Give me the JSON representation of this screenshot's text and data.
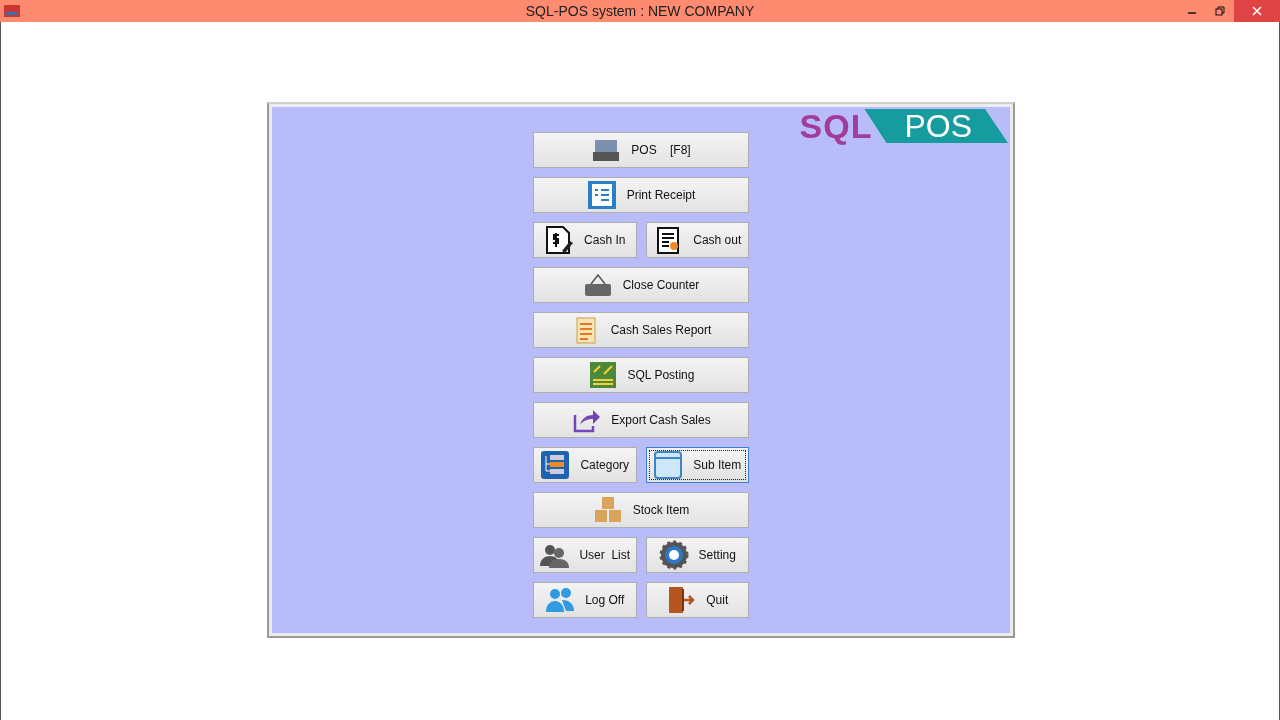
{
  "window": {
    "title": "SQL-POS system : NEW COMPANY"
  },
  "logo": {
    "left": "SQL",
    "right": "POS"
  },
  "rows": [
    [
      {
        "label": "POS    [F8]",
        "kind": "register",
        "focused": false
      }
    ],
    [
      {
        "label": "Print Receipt",
        "kind": "receipt",
        "focused": false
      }
    ],
    [
      {
        "label": "Cash In",
        "kind": "dollar-doc",
        "focused": false
      },
      {
        "label": "Cash out",
        "kind": "notepad",
        "focused": false
      }
    ],
    [
      {
        "label": "Close Counter",
        "kind": "closed-sign",
        "focused": false
      }
    ],
    [
      {
        "label": "Cash Sales Report",
        "kind": "report",
        "focused": false
      }
    ],
    [
      {
        "label": "SQL Posting",
        "kind": "posting",
        "focused": false
      }
    ],
    [
      {
        "label": "Export Cash Sales",
        "kind": "export",
        "focused": false
      }
    ],
    [
      {
        "label": "Category",
        "kind": "category",
        "focused": false
      },
      {
        "label": "Sub Item",
        "kind": "window",
        "focused": true
      }
    ],
    [
      {
        "label": "Stock Item",
        "kind": "boxes",
        "focused": false
      }
    ],
    [
      {
        "label": "User  List",
        "kind": "users",
        "focused": false
      },
      {
        "label": "Setting",
        "kind": "gear",
        "focused": false
      }
    ],
    [
      {
        "label": "Log Off",
        "kind": "people",
        "focused": false
      },
      {
        "label": "Quit",
        "kind": "exit",
        "focused": false
      }
    ]
  ]
}
